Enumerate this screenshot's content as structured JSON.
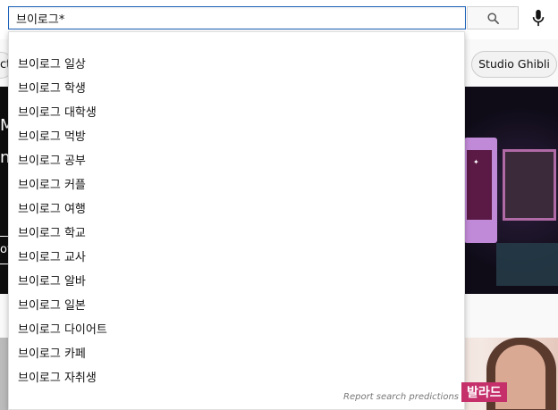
{
  "search": {
    "query": "브이로그*",
    "search_icon": "search-icon",
    "mic_icon": "microphone-icon"
  },
  "chips": {
    "partial_label": "ct",
    "studio_ghibli": "Studio Ghibli"
  },
  "banner": {
    "line1": "M",
    "line2": "n",
    "button": "ov"
  },
  "suggestions": {
    "items": [
      "브이로그 일상",
      "브이로그 학생",
      "브이로그 대학생",
      "브이로그 먹방",
      "브이로그 공부",
      "브이로그 커플",
      "브이로그 여행",
      "브이로그 학교",
      "브이로그 교사",
      "브이로그 알바",
      "브이로그 일본",
      "브이로그 다이어트",
      "브이로그 카페",
      "브이로그 자취생"
    ],
    "report_link": "Report search predictions"
  },
  "thumbnail": {
    "label": "발라드"
  },
  "colors": {
    "accent": "#1c62b9",
    "chip_bg": "#f2f2f2",
    "thumb_label": "#c5306b"
  }
}
